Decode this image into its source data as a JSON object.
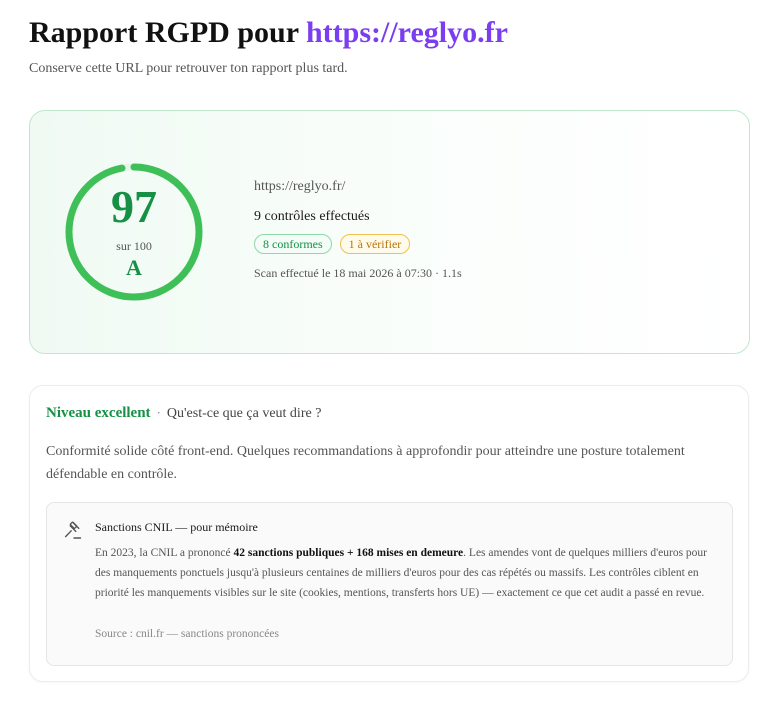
{
  "header": {
    "title_prefix": "Rapport RGPD pour ",
    "title_url": "https://reglyo.fr",
    "subtitle": "Conserve cette URL pour retrouver ton rapport plus tard."
  },
  "score": {
    "value": "97",
    "out_of": "sur 100",
    "grade": "A",
    "fraction": 0.97,
    "gauge_color": "#3fbf58",
    "score_color": "#159045"
  },
  "summary": {
    "url": "https://reglyo.fr/",
    "checks": "9 contrôles effectués",
    "badge_ok": "8 conformes",
    "badge_warn": "1 à vérifier",
    "scan": "Scan effectué le 18 mai 2026 à 07:30 · 1.1s"
  },
  "level": {
    "name": "Niveau excellent",
    "separator": "·",
    "help": "Qu'est-ce que ça veut dire ?",
    "description": "Conformité solide côté front-end. Quelques recommandations à approfondir pour atteindre une posture totalement défendable en contrôle."
  },
  "note": {
    "icon": "gavel-icon",
    "title": "Sanctions CNIL — pour mémoire",
    "body_intro": "En 2023, la CNIL a prononcé ",
    "body_bold": "42 sanctions publiques + 168 mises en demeure",
    "body_rest": ". Les amendes vont de quelques milliers d'euros pour des manquements ponctuels jusqu'à plusieurs centaines de milliers d'euros pour des cas répétés ou massifs. Les contrôles ciblent en priorité les manquements visibles sur le site (cookies, mentions, transferts hors UE) — exactement ce que cet audit a passé en revue.",
    "source": "Source : cnil.fr — sanctions prononcées"
  }
}
